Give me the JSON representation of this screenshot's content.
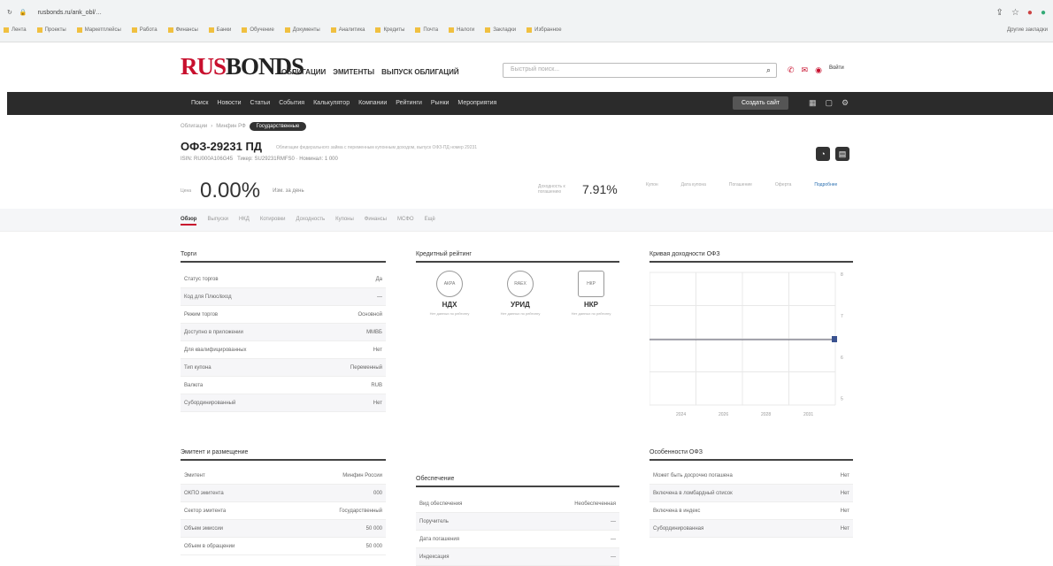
{
  "browser": {
    "url": "rusbonds.ru/ank_obl/…",
    "bookmarks": [
      "Лента",
      "Проекты",
      "Маркетплейсы",
      "Работа",
      "Финансы",
      "Банки",
      "Обучение",
      "Документы",
      "Аналитика",
      "Кредиты",
      "Почта",
      "Налоги",
      "Закладки",
      "Избранное"
    ],
    "bookmarks_right": "Другие закладки"
  },
  "site": {
    "logo_a": "RUS",
    "logo_b": "BONDS",
    "main_nav": [
      "ОБЛИГАЦИИ",
      "ЭМИТЕНТЫ",
      "ВЫПУСК ОБЛИГАЦИЙ"
    ],
    "search_placeholder": "Быстрый поиск...",
    "login": "Войти",
    "dark_nav": [
      "Поиск",
      "Новости",
      "Статьи",
      "События",
      "Калькулятор",
      "Компании",
      "Рейтинги",
      "Рынки",
      "Мероприятия"
    ],
    "create_label": "Создать сайт",
    "breadcrumb": [
      "Облигации",
      "Минфин РФ"
    ],
    "breadcrumb_pill": "Государственные",
    "bond_title": "ОФЗ-29231 ПД",
    "bond_desc": "Облигации федерального займа с переменным купонным доходом, выпуск ОФЗ-ПД номер 29231",
    "isin_label": "ISIN: RU000A106G45",
    "isin_extra": "Тикер: SU29231RMFS0 · Номинал: 1 000",
    "price_label": "Цена",
    "price": "0.00%",
    "price_sub": "Изм. за день",
    "ytm_label": "Доходность к погашению",
    "ytm": "7.91%",
    "stats": [
      "Купон",
      "Дата купона",
      "Погашение",
      "Оферта"
    ],
    "stats_link": "Подробнее",
    "tabs": [
      "Обзор",
      "Выпуски",
      "НКД",
      "Котировки",
      "Доходность",
      "Купоны",
      "Финансы",
      "МСФО",
      "Ещё"
    ]
  },
  "trade": {
    "title": "Торги",
    "rows": [
      [
        "Статус торгов",
        "Да"
      ],
      [
        "Код для Плюс/вход",
        "—"
      ],
      [
        "Режим торгов",
        "Основной"
      ],
      [
        "Доступно в приложении",
        "ММВБ"
      ],
      [
        "Для квалифицированных",
        "Нет"
      ],
      [
        "Тип купона",
        "Переменный"
      ],
      [
        "Валюта",
        "RUB"
      ],
      [
        "Субординированный",
        "Нет"
      ]
    ]
  },
  "ratings": {
    "title": "Кредитный рейтинг",
    "items": [
      {
        "seal": "АКРА",
        "code": "НДХ",
        "desc": "Нет данных по рейтингу"
      },
      {
        "seal": "RAEX",
        "code": "УРИД",
        "desc": "Нет данных по рейтингу"
      },
      {
        "seal": "НКР",
        "code": "НКР",
        "desc": "Нет данных по рейтингу"
      }
    ]
  },
  "chart": {
    "title": "Кривая доходности ОФЗ",
    "xticks": [
      "2024",
      "2026",
      "2028",
      "2031"
    ],
    "yticks": [
      "8",
      "7",
      "6",
      "5"
    ]
  },
  "issuer": {
    "title": "Эмитент и размещение",
    "rows": [
      [
        "Эмитент",
        "Минфин России"
      ],
      [
        "ОКПО эмитента",
        "000"
      ],
      [
        "Сектор эмитента",
        "Государственный"
      ],
      [
        "Объем эмиссии",
        "50 000"
      ],
      [
        "Объем в обращении",
        "50 000"
      ]
    ]
  },
  "security": {
    "title": "Обеспечение",
    "rows": [
      [
        "Вид обеспечения",
        "Необеспеченная"
      ],
      [
        "Поручитель",
        "—"
      ],
      [
        "Дата погашения",
        "—"
      ],
      [
        "Индексация",
        "—"
      ]
    ]
  },
  "features": {
    "title": "Особенности ОФЗ",
    "rows": [
      [
        "Может быть досрочно погашена",
        "Нет"
      ],
      [
        "Включена в ломбардный список",
        "Нет"
      ],
      [
        "Включена в индекс",
        "Нет"
      ],
      [
        "Субординированная",
        "Нет"
      ]
    ]
  }
}
